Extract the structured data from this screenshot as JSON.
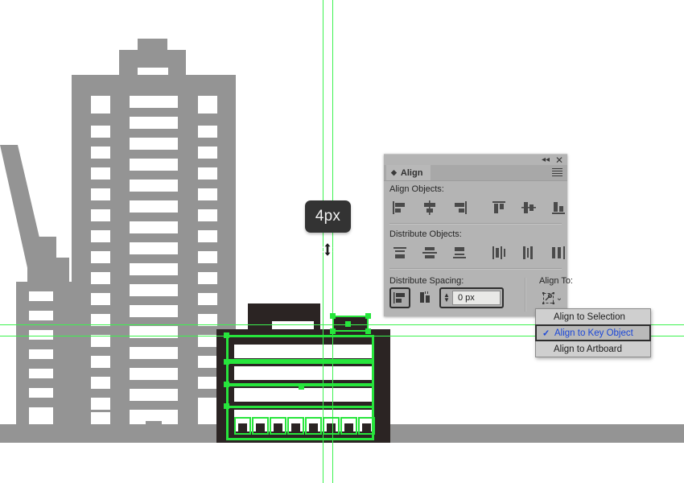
{
  "app": {
    "context": "vector-illustration-editor-canvas"
  },
  "tooltip": {
    "measurement": "4px",
    "cursor_icon": "vertical-resize-double-arrow-cursor"
  },
  "align_panel": {
    "title": "Align",
    "tab_icon": "panel-diamond-icon",
    "collapse_icon": "collapse-double-chevron-icon",
    "close_icon": "close-icon",
    "menu_icon": "panel-options-hamburger-icon",
    "sections": [
      {
        "label": "Align Objects:",
        "buttons": [
          "align-horizontal-left-icon",
          "align-horizontal-center-icon",
          "align-horizontal-right-icon",
          "align-vertical-top-icon",
          "align-vertical-center-icon",
          "align-vertical-bottom-icon"
        ]
      },
      {
        "label": "Distribute Objects:",
        "buttons": [
          "distribute-vertical-top-icon",
          "distribute-vertical-center-icon",
          "distribute-vertical-bottom-icon",
          "distribute-horizontal-left-icon",
          "distribute-horizontal-center-icon",
          "distribute-horizontal-right-icon"
        ]
      }
    ],
    "distribute_spacing": {
      "label": "Distribute Spacing:",
      "buttons": [
        "distribute-vertical-spacing-icon",
        "distribute-horizontal-spacing-icon"
      ],
      "value": "0 px",
      "placeholder": "0 px",
      "stepper_up": "▲",
      "stepper_down": "▼"
    },
    "align_to": {
      "label": "Align To:",
      "button_icon": "align-to-key-object-icon",
      "chevron": "⌄"
    }
  },
  "dropdown": {
    "items": [
      {
        "label": "Align to Selection",
        "checked": false,
        "selected": false
      },
      {
        "label": "Align to Key Object",
        "checked": true,
        "selected": true
      },
      {
        "label": "Align to Artboard",
        "checked": false,
        "selected": false
      }
    ],
    "check_glyph": "✓"
  },
  "colors": {
    "selection_green": "#27e53c",
    "guide_green": "#3cf24f",
    "building_gray": "#949494",
    "building_dark": "#2b2423",
    "panel_gray": "#b4b4b4",
    "menu_highlight_text": "#1a46d8",
    "tooltip_bg": "#333333"
  },
  "canvas": {
    "description": "city-skyline-illustration",
    "selected_object": "dark-building-front-facade"
  }
}
